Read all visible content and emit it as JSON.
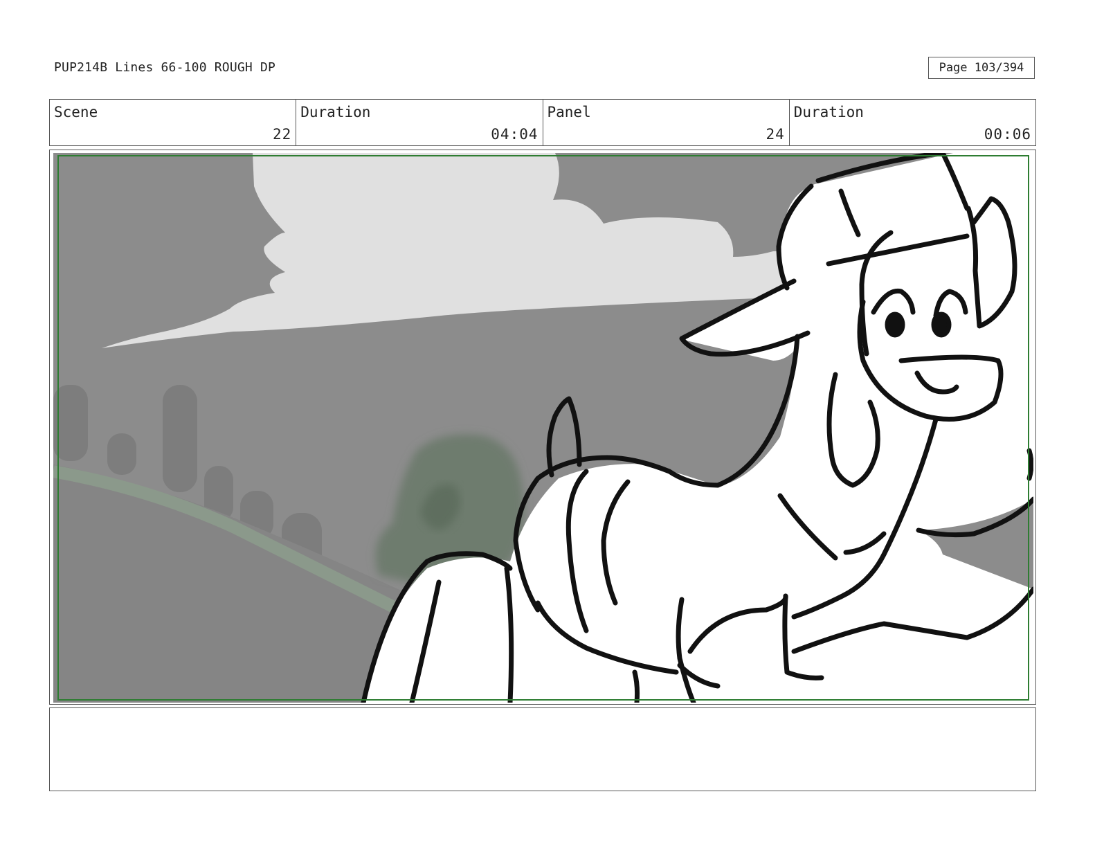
{
  "header": {
    "title": "PUP214B Lines 66-100 ROUGH DP",
    "page": "Page 103/394"
  },
  "info": {
    "scene_label": "Scene",
    "scene_value": "22",
    "scene_duration_label": "Duration",
    "scene_duration_value": "04:04",
    "panel_label": "Panel",
    "panel_value": "24",
    "panel_duration_label": "Duration",
    "panel_duration_value": "00:06"
  },
  "colors": {
    "sky": "#8c8c8c",
    "cloud": "#e0e0e0",
    "hill": "#7d7d7d",
    "safe_frame": "#2e7d32",
    "haystack": "#f2c40c",
    "orange": "#f07a10"
  },
  "notes": ""
}
